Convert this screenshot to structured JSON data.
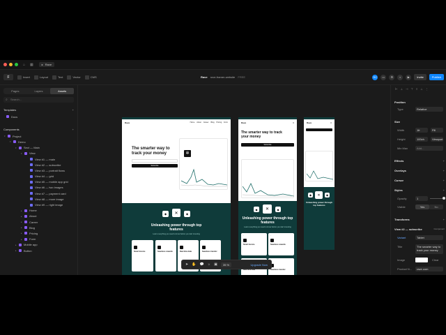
{
  "window": {
    "tab_label": "Rave"
  },
  "toolbar": {
    "tools": [
      "Insert",
      "Layout",
      "Text",
      "Vector",
      "CMS"
    ],
    "project_name": "Rave",
    "project_path": "rove-framer-website",
    "project_badge": "FREE",
    "invite_label": "Invite",
    "publish_label": "Publish"
  },
  "left_panel": {
    "tabs": [
      "Pages",
      "Layers",
      "Assets"
    ],
    "active_tab": "Assets",
    "search_placeholder": "Search...",
    "templates_heading": "Templates",
    "templates": [
      "Docs"
    ],
    "components_heading": "Components",
    "tree": [
      {
        "label": "Project",
        "depth": 0,
        "caret": "▾"
      },
      {
        "label": "Demo",
        "depth": 1,
        "caret": "▾"
      },
      {
        "label": "Sect — Main",
        "depth": 2,
        "caret": "▾"
      },
      {
        "label": "View",
        "depth": 3,
        "caret": "▾"
      },
      {
        "label": "View #1 — main",
        "depth": 4,
        "caret": ""
      },
      {
        "label": "View #2 — subscribe",
        "depth": 4,
        "caret": ""
      },
      {
        "label": "View #3 — portrait flows",
        "depth": 4,
        "caret": ""
      },
      {
        "label": "View #4 — grid",
        "depth": 4,
        "caret": ""
      },
      {
        "label": "View #5 — mobile app grid",
        "depth": 4,
        "caret": ""
      },
      {
        "label": "View #6 — two images",
        "depth": 4,
        "caret": ""
      },
      {
        "label": "View #7 — payment card",
        "depth": 4,
        "caret": ""
      },
      {
        "label": "View #8 — more image",
        "depth": 4,
        "caret": ""
      },
      {
        "label": "View #9 — right image",
        "depth": 4,
        "caret": ""
      },
      {
        "label": "Home",
        "depth": 3,
        "caret": "▸"
      },
      {
        "label": "About",
        "depth": 3,
        "caret": "▸"
      },
      {
        "label": "Career",
        "depth": 3,
        "caret": "▸"
      },
      {
        "label": "Blog",
        "depth": 3,
        "caret": "▸"
      },
      {
        "label": "Pricing",
        "depth": 3,
        "caret": "▸"
      },
      {
        "label": "Form",
        "depth": 3,
        "caret": "▸"
      },
      {
        "label": "Mobile app",
        "depth": 2,
        "caret": "▸"
      },
      {
        "label": "Button",
        "depth": 2,
        "caret": "▸"
      }
    ]
  },
  "canvas": {
    "brand": "Rave",
    "nav_links": [
      "Home",
      "About",
      "Career",
      "Blog",
      "Pricing",
      "Form"
    ],
    "hero_title": "The smarter way to track your money",
    "hero_button": "Subscribe",
    "features_title": "Unleashing power through top features",
    "features_sub": "Learn everything you need to know before you start investing",
    "feature_cards": [
      "Smart Invoice",
      "Seamless rewards",
      "Real time data",
      "Seamless transfer"
    ],
    "tablet_title": "The smarter way to track your money",
    "float_toolbar": {
      "zoom": "35 %",
      "upgrade": "Upgrade Now"
    }
  },
  "right_panel": {
    "position": {
      "heading": "Position",
      "type_label": "Type",
      "type_value": "Relative"
    },
    "size": {
      "heading": "Size",
      "width_label": "Width",
      "width_value": "1fr",
      "width_mode": "Fill",
      "height_label": "Height",
      "height_value": "100vh",
      "height_mode": "Viewport",
      "minmax_label": "Min Max",
      "minmax_value": "Add..."
    },
    "effects": "Effects",
    "overlays": "Overlays",
    "cursor": "Cursor",
    "styles": {
      "heading": "Styles",
      "opacity_label": "Opacity",
      "opacity_value": "1",
      "visible_label": "Visible",
      "visible_yes": "Yes",
      "visible_no": "No"
    },
    "transforms": "Transforms",
    "component": {
      "heading": "View #2 — subscribe",
      "badge": "Component",
      "variant_label": "Variant",
      "variant_value": "Tablet",
      "title_label": "Title",
      "title_value": "The smarter way to track your money",
      "image_label": "Image",
      "image_action": "Clear",
      "product_label": "Product N...",
      "product_value": "rave.com"
    }
  },
  "colors": {
    "accent": "#0f87ff",
    "teal": "#0f3b3a",
    "canvas_bg": "#1b1b1b"
  }
}
